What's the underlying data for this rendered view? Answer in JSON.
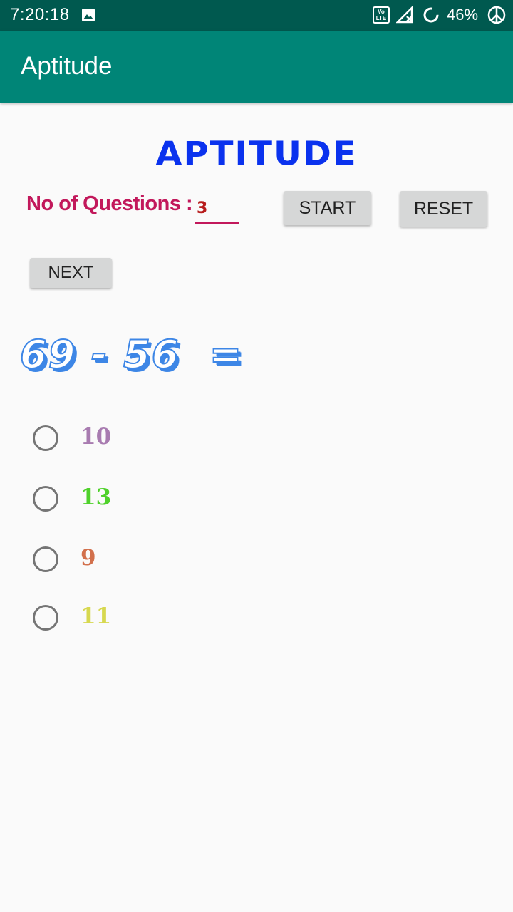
{
  "status_bar": {
    "time": "7:20:18",
    "battery": "46%",
    "icons": [
      "image-icon",
      "volte-icon",
      "signal-icon",
      "sync-icon",
      "peace-icon"
    ]
  },
  "app_bar": {
    "title": "Aptitude"
  },
  "main": {
    "headline": "APTITUDE",
    "questions_label": "No of Questions :",
    "questions_value": "3",
    "start_label": "START",
    "reset_label": "RESET",
    "next_label": "NEXT",
    "question": "69 - 56  =",
    "options": [
      {
        "label": "10",
        "color": "#a87bb0"
      },
      {
        "label": "13",
        "color": "#4fd12b"
      },
      {
        "label": "9",
        "color": "#d2704c"
      },
      {
        "label": "11",
        "color": "#d7d84f"
      }
    ]
  },
  "colors": {
    "status_bar": "#00594f",
    "app_bar": "#008577",
    "headline": "#0a32ee",
    "label": "#c2185b",
    "input_value": "#b71c1c",
    "question": "#3d86e6"
  }
}
